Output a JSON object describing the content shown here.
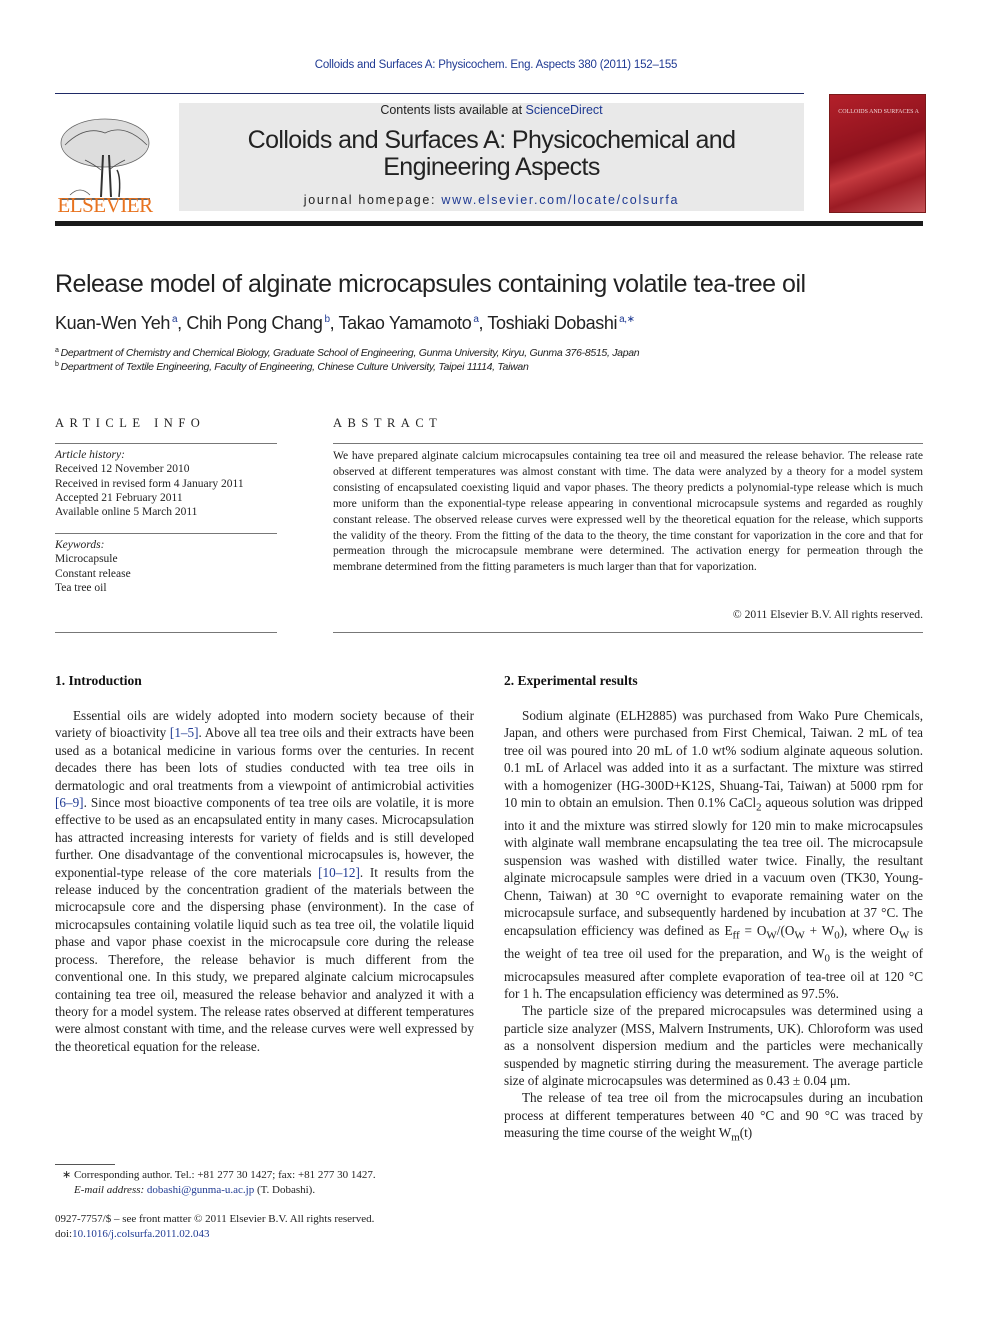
{
  "header": {
    "citation": "Colloids and Surfaces A: Physicochem. Eng. Aspects 380 (2011) 152–155",
    "contents_prefix": "Contents lists available at ",
    "contents_link": "ScienceDirect",
    "journal_title_line1": "Colloids and Surfaces A: Physicochemical and",
    "journal_title_line2": "Engineering Aspects",
    "homepage_prefix": "journal homepage: ",
    "homepage_link": "www.elsevier.com/locate/colsurfa",
    "publisher_logo_text": "ELSEVIER",
    "cover_text": "COLLOIDS AND SURFACES A",
    "colors": {
      "brand_orange": "#e8731f",
      "link_blue": "#1f3a93",
      "cover_red": "#b3202a"
    }
  },
  "article": {
    "title": "Release model of alginate microcapsules containing volatile tea-tree oil",
    "authors": [
      {
        "name": "Kuan-Wen Yeh",
        "sup": "a"
      },
      {
        "name": "Chih Pong Chang",
        "sup": "b"
      },
      {
        "name": "Takao Yamamoto",
        "sup": "a"
      },
      {
        "name": "Toshiaki Dobashi",
        "sup": "a,∗"
      }
    ],
    "affiliations": [
      {
        "mark": "a",
        "text": "Department of Chemistry and Chemical Biology, Graduate School of Engineering, Gunma University, Kiryu, Gunma 376-8515, Japan"
      },
      {
        "mark": "b",
        "text": "Department of Textile Engineering, Faculty of Engineering, Chinese Culture University, Taipei 11114, Taiwan"
      }
    ]
  },
  "article_info": {
    "heading": "ARTICLE INFO",
    "history_label": "Article history:",
    "history": [
      "Received 12 November 2010",
      "Received in revised form 4 January 2011",
      "Accepted 21 February 2011",
      "Available online 5 March 2011"
    ],
    "keywords_label": "Keywords:",
    "keywords": [
      "Microcapsule",
      "Constant release",
      "Tea tree oil"
    ]
  },
  "abstract": {
    "heading": "ABSTRACT",
    "text": "We have prepared alginate calcium microcapsules containing tea tree oil and measured the release behavior. The release rate observed at different temperatures was almost constant with time. The data were analyzed by a theory for a model system consisting of encapsulated coexisting liquid and vapor phases. The theory predicts a polynomial-type release which is much more uniform than the exponential-type release appearing in conventional microcapsule systems and regarded as roughly constant release. The observed release curves were expressed well by the theoretical equation for the release, which supports the validity of the theory. From the fitting of the data to the theory, the time constant for vaporization in the core and that for permeation through the microcapsule membrane were determined. The activation energy for permeation through the membrane determined from the fitting parameters is much larger than that for vaporization.",
    "copyright": "© 2011 Elsevier B.V. All rights reserved."
  },
  "sections": {
    "intro": {
      "heading": "1.  Introduction",
      "p1_a": "Essential oils are widely adopted into modern society because of their variety of bioactivity ",
      "ref1": "[1–5]",
      "p1_b": ". Above all tea tree oils and their extracts have been used as a botanical medicine in various forms over the centuries. In recent decades there has been lots of studies conducted with tea tree oils in dermatologic and oral treatments from a viewpoint of antimicrobial activities ",
      "ref2": "[6–9]",
      "p1_c": ". Since most bioactive components of tea tree oils are volatile, it is more effective to be used as an encapsulated entity in many cases. Microcapsulation has attracted increasing interests for variety of fields and is still developed further. One disadvantage of the conventional microcapsules is, however, the exponential-type release of the core materials ",
      "ref3": "[10–12]",
      "p1_d": ". It results from the release induced by the concentration gradient of the materials between the microcapsule core and the dispersing phase (environment). In the case of microcapsules containing volatile liquid such as tea tree oil, the volatile liquid phase and vapor phase coexist in the microcapsule core during the release process. Therefore, the release behavior is much different from the conventional one. In this study, we prepared alginate calcium microcapsules containing tea tree oil, measured the release behavior and analyzed it with a theory for a model system. The release rates observed at different temperatures were almost constant with time, and the release curves were well expressed by the theoretical equation for the release."
    },
    "experimental": {
      "heading": "2.  Experimental results",
      "p1_a": "Sodium alginate (ELH2885) was purchased from Wako Pure Chemicals, Japan, and others were purchased from First Chemical, Taiwan. 2 mL of tea tree oil was poured into 20 mL of 1.0 wt% sodium alginate aqueous solution. 0.1 mL of Arlacel was added into it as a surfactant. The mixture was stirred with a homogenizer (HG-300D+K12S, Shuang-Tai, Taiwan) at 5000 rpm for 10 min to obtain an emulsion. Then 0.1% CaCl",
      "p1_sub": "2",
      "p1_b": " aqueous solution was dripped into it and the mixture was stirred slowly for 120 min to make microcapsules with alginate wall membrane encapsulating the tea tree oil. The microcapsule suspension was washed with distilled water twice. Finally, the resultant alginate microcapsule samples were dried in a vacuum oven (TK30, Young-Chenn, Taiwan) at 30 °C overnight to evaporate remaining water on the microcapsule surface, and subsequently hardened by incubation at 37 °C. The encapsulation efficiency was defined as E",
      "p1_sub_ff": "ff",
      "p1_c": " = O",
      "p1_sub_w1": "W",
      "p1_d": "/(O",
      "p1_sub_w2": "W",
      "p1_e": " + W",
      "p1_sub_0a": "0",
      "p1_f": "), where O",
      "p1_sub_w3": "W",
      "p1_g": " is the weight of tea tree oil used for the preparation, and W",
      "p1_sub_0b": "0",
      "p1_h": " is the weight of microcapsules measured after complete evaporation of tea-tree oil at 120 °C for 1 h. The encapsulation efficiency was determined as 97.5%.",
      "p2": "The particle size of the prepared microcapsules was determined using a particle size analyzer (MSS, Malvern Instruments, UK). Chloroform was used as a nonsolvent dispersion medium and the particles were mechanically suspended by magnetic stirring during the measurement. The average particle size of alginate microcapsules was determined as 0.43 ± 0.04 μm.",
      "p3_a": "The release of tea tree oil from the microcapsules during an incubation process at different temperatures between 40 °C and 90 °C was traced by measuring the time course of the weight W",
      "p3_sub": "m",
      "p3_b": "(t)"
    }
  },
  "footnotes": {
    "corresponding": "∗ Corresponding author. Tel.: +81 277 30 1427; fax: +81 277 30 1427.",
    "email_label": "E-mail address: ",
    "email": "dobashi@gunma-u.ac.jp",
    "email_suffix": " (T. Dobashi).",
    "front_matter": "0927-7757/$ – see front matter © 2011 Elsevier B.V. All rights reserved.",
    "doi_label": "doi:",
    "doi": "10.1016/j.colsurfa.2011.02.043"
  }
}
